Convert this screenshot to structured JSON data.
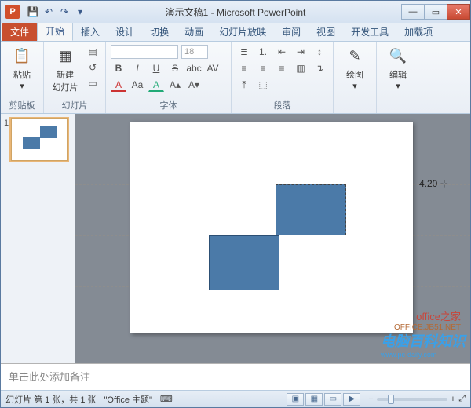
{
  "title": "演示文稿1 - Microsoft PowerPoint",
  "app_icon_letter": "P",
  "qat": {
    "save": "💾",
    "undo": "↶",
    "redo": "↷",
    "more": "▾"
  },
  "win": {
    "min": "—",
    "max": "▭",
    "close": "✕"
  },
  "tabs": {
    "file": "文件",
    "home": "开始",
    "insert": "插入",
    "design": "设计",
    "transitions": "切换",
    "animations": "动画",
    "slideshow": "幻灯片放映",
    "review": "审阅",
    "view": "视图",
    "developer": "开发工具",
    "addins": "加载项"
  },
  "ribbon": {
    "clipboard": {
      "label": "剪贴板",
      "paste": "粘贴",
      "paste_icon": "📋"
    },
    "slides": {
      "label": "幻灯片",
      "new_slide_l1": "新建",
      "new_slide_l2": "幻灯片",
      "new_icon": "▦"
    },
    "font": {
      "label": "字体",
      "font_family": "",
      "font_size": "18",
      "bold": "B",
      "italic": "I",
      "underline": "U",
      "strike": "S",
      "shadow": "abc",
      "spacing": "AV",
      "clear": "Aa",
      "colorA": "A",
      "highlight": "A",
      "grow": "A▴",
      "shrink": "A▾"
    },
    "paragraph": {
      "label": "段落",
      "bullets": "≣",
      "numbering": "1.",
      "indent_dec": "⇤",
      "indent_inc": "⇥",
      "linesp": "↕",
      "align_l": "≡",
      "align_c": "≡",
      "align_r": "≡",
      "columns": "▥",
      "direction": "↴"
    },
    "drawing": {
      "label": "绘图",
      "icon": "✎"
    },
    "editing": {
      "label": "编辑",
      "icon": "🔍"
    }
  },
  "thumbs": {
    "num": "1"
  },
  "editor": {
    "dim_value": "4.20",
    "watermark_a": "office之家",
    "watermark_b": "OFFICE.JB51.NET",
    "wm2_main": "电脑百科知识",
    "wm2_sub": "www.pc-daily.com"
  },
  "notes": {
    "placeholder": "单击此处添加备注"
  },
  "status": {
    "slide_info": "幻灯片 第 1 张，共 1 张",
    "theme": "\"Office 主题\"",
    "lang": "⌨"
  }
}
